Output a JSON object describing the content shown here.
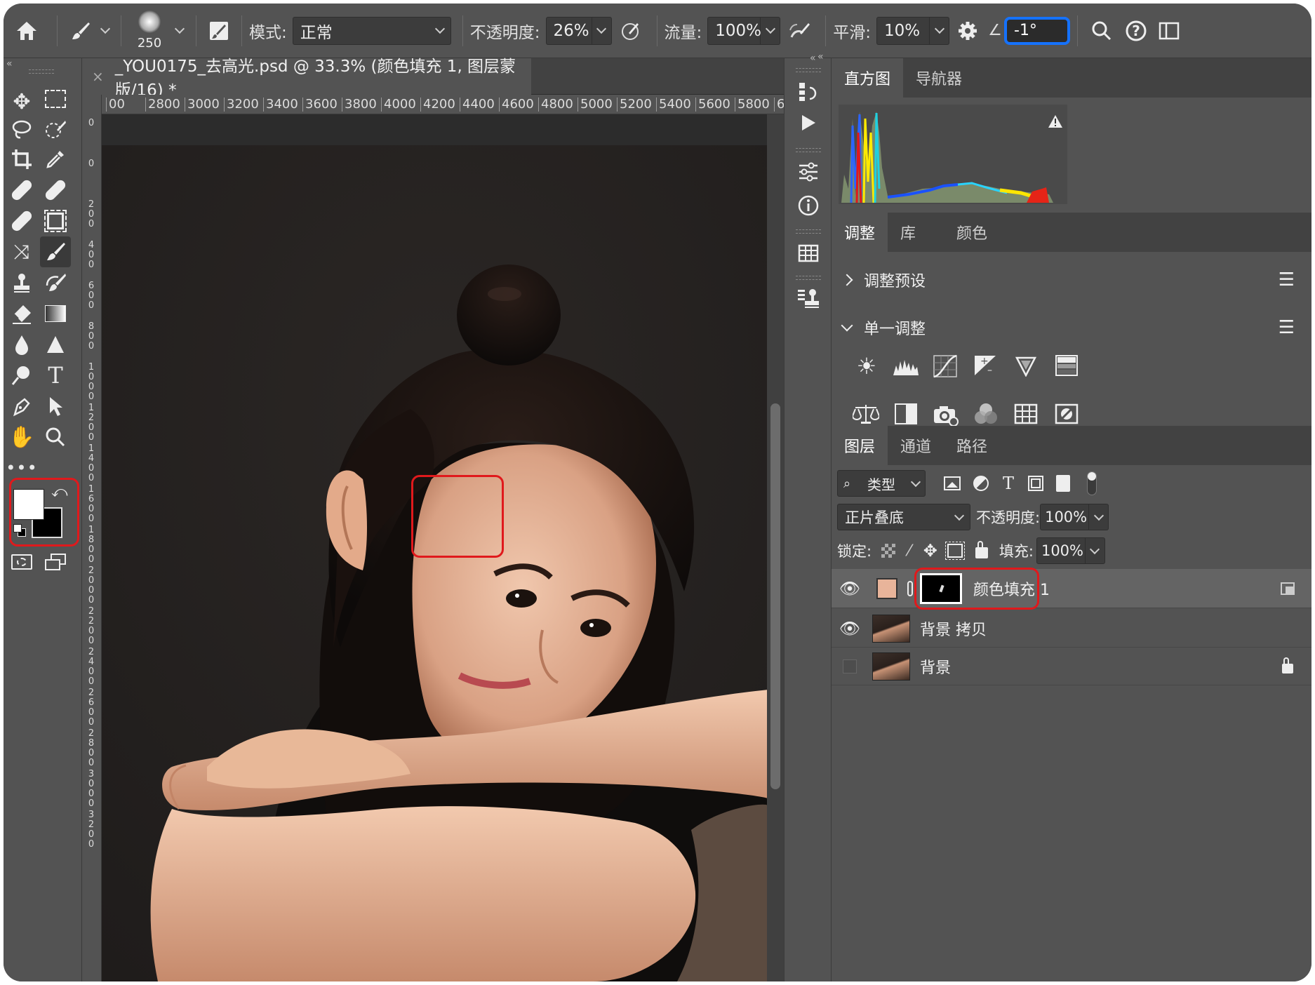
{
  "options_bar": {
    "brush_size": "250",
    "mode_label": "模式:",
    "mode_value": "正常",
    "opacity_label": "不透明度:",
    "opacity_value": "26%",
    "flow_label": "流量:",
    "flow_value": "100%",
    "smoothing_label": "平滑:",
    "smoothing_value": "10%",
    "angle_value": "-1°"
  },
  "document": {
    "tab_title": "_YOU0175_去高光.psd @ 33.3% (颜色填充 1, 图层蒙版/16) *",
    "ruler_top": [
      "00",
      "2800",
      "3000",
      "3200",
      "3400",
      "3600",
      "3800",
      "4000",
      "4200",
      "4400",
      "4600",
      "4800",
      "5000",
      "5200",
      "5400",
      "5600",
      "5800",
      "6"
    ],
    "ruler_left": [
      "0",
      "0",
      "200",
      "400",
      "600",
      "800",
      "1000",
      "1200",
      "1400",
      "1600",
      "1800",
      "2000",
      "2200",
      "2400",
      "2600",
      "2800",
      "3000",
      "3200"
    ]
  },
  "histogram_panel": {
    "tabs": [
      "直方图",
      "导航器"
    ],
    "warning_icon": "warning-icon"
  },
  "adjustments_panel": {
    "tabs": [
      "调整",
      "库",
      "颜色"
    ],
    "presets_label": "调整预设",
    "single_label": "单一调整"
  },
  "layers_panel": {
    "tabs": [
      "图层",
      "通道",
      "路径"
    ],
    "filter_label": "类型",
    "blend_mode": "正片叠底",
    "opacity_label": "不透明度:",
    "opacity_value": "100%",
    "lock_label": "锁定:",
    "fill_label": "填充:",
    "fill_value": "100%",
    "layers": [
      {
        "name": "颜色填充 1",
        "visible": true
      },
      {
        "name": "背景 拷贝",
        "visible": true
      },
      {
        "name": "背景",
        "visible": false,
        "locked": true
      }
    ]
  },
  "colors": {
    "foreground": "#ffffff",
    "background": "#000000",
    "fill_swatch": "#e8b49a",
    "highlight_red": "#e0191c",
    "highlight_blue": "#1572ff"
  }
}
